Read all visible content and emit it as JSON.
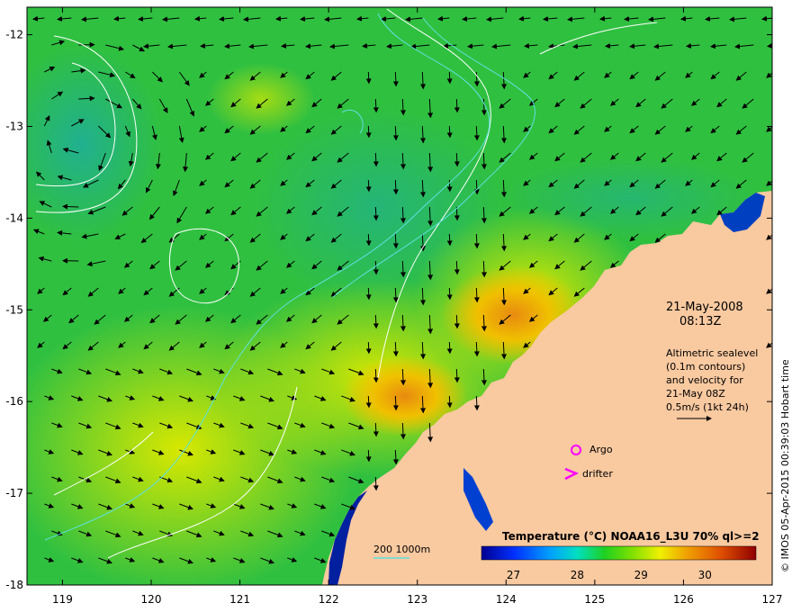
{
  "map": {
    "lon_ticks": [
      "119",
      "120",
      "121",
      "122",
      "123",
      "124",
      "125",
      "126",
      "127"
    ],
    "lat_ticks": [
      "-12",
      "-13",
      "-14",
      "-15",
      "-16",
      "-17",
      "-18"
    ],
    "lon_range": [
      118.6,
      127.0
    ],
    "lat_range": [
      -11.7,
      -18.0
    ]
  },
  "annotation": {
    "date": "21-May-2008",
    "time": "08:13Z",
    "lines": [
      "Altimetric sealevel",
      "(0.1m contours)",
      "and velocity for",
      "21-May 08Z",
      "0.5m/s (1kt 24h)"
    ]
  },
  "legend": {
    "argo": "Argo",
    "drifter": "drifter",
    "isobath": "200  1000m"
  },
  "colorbar": {
    "title": "Temperature (°C) NOAA16_L3U 70% ql>=2",
    "ticks": [
      "27",
      "28",
      "29",
      "30"
    ],
    "range": [
      26.5,
      30.8
    ]
  },
  "credit": "© IMOS 05-Apr-2015 00:39:03 Hobart time",
  "colors": {
    "land": "#f9c9a0",
    "argo": "#ff00ff",
    "drifter": "#ff00ff",
    "isobath": "#5fe0e0",
    "contour": "#ffffff"
  }
}
